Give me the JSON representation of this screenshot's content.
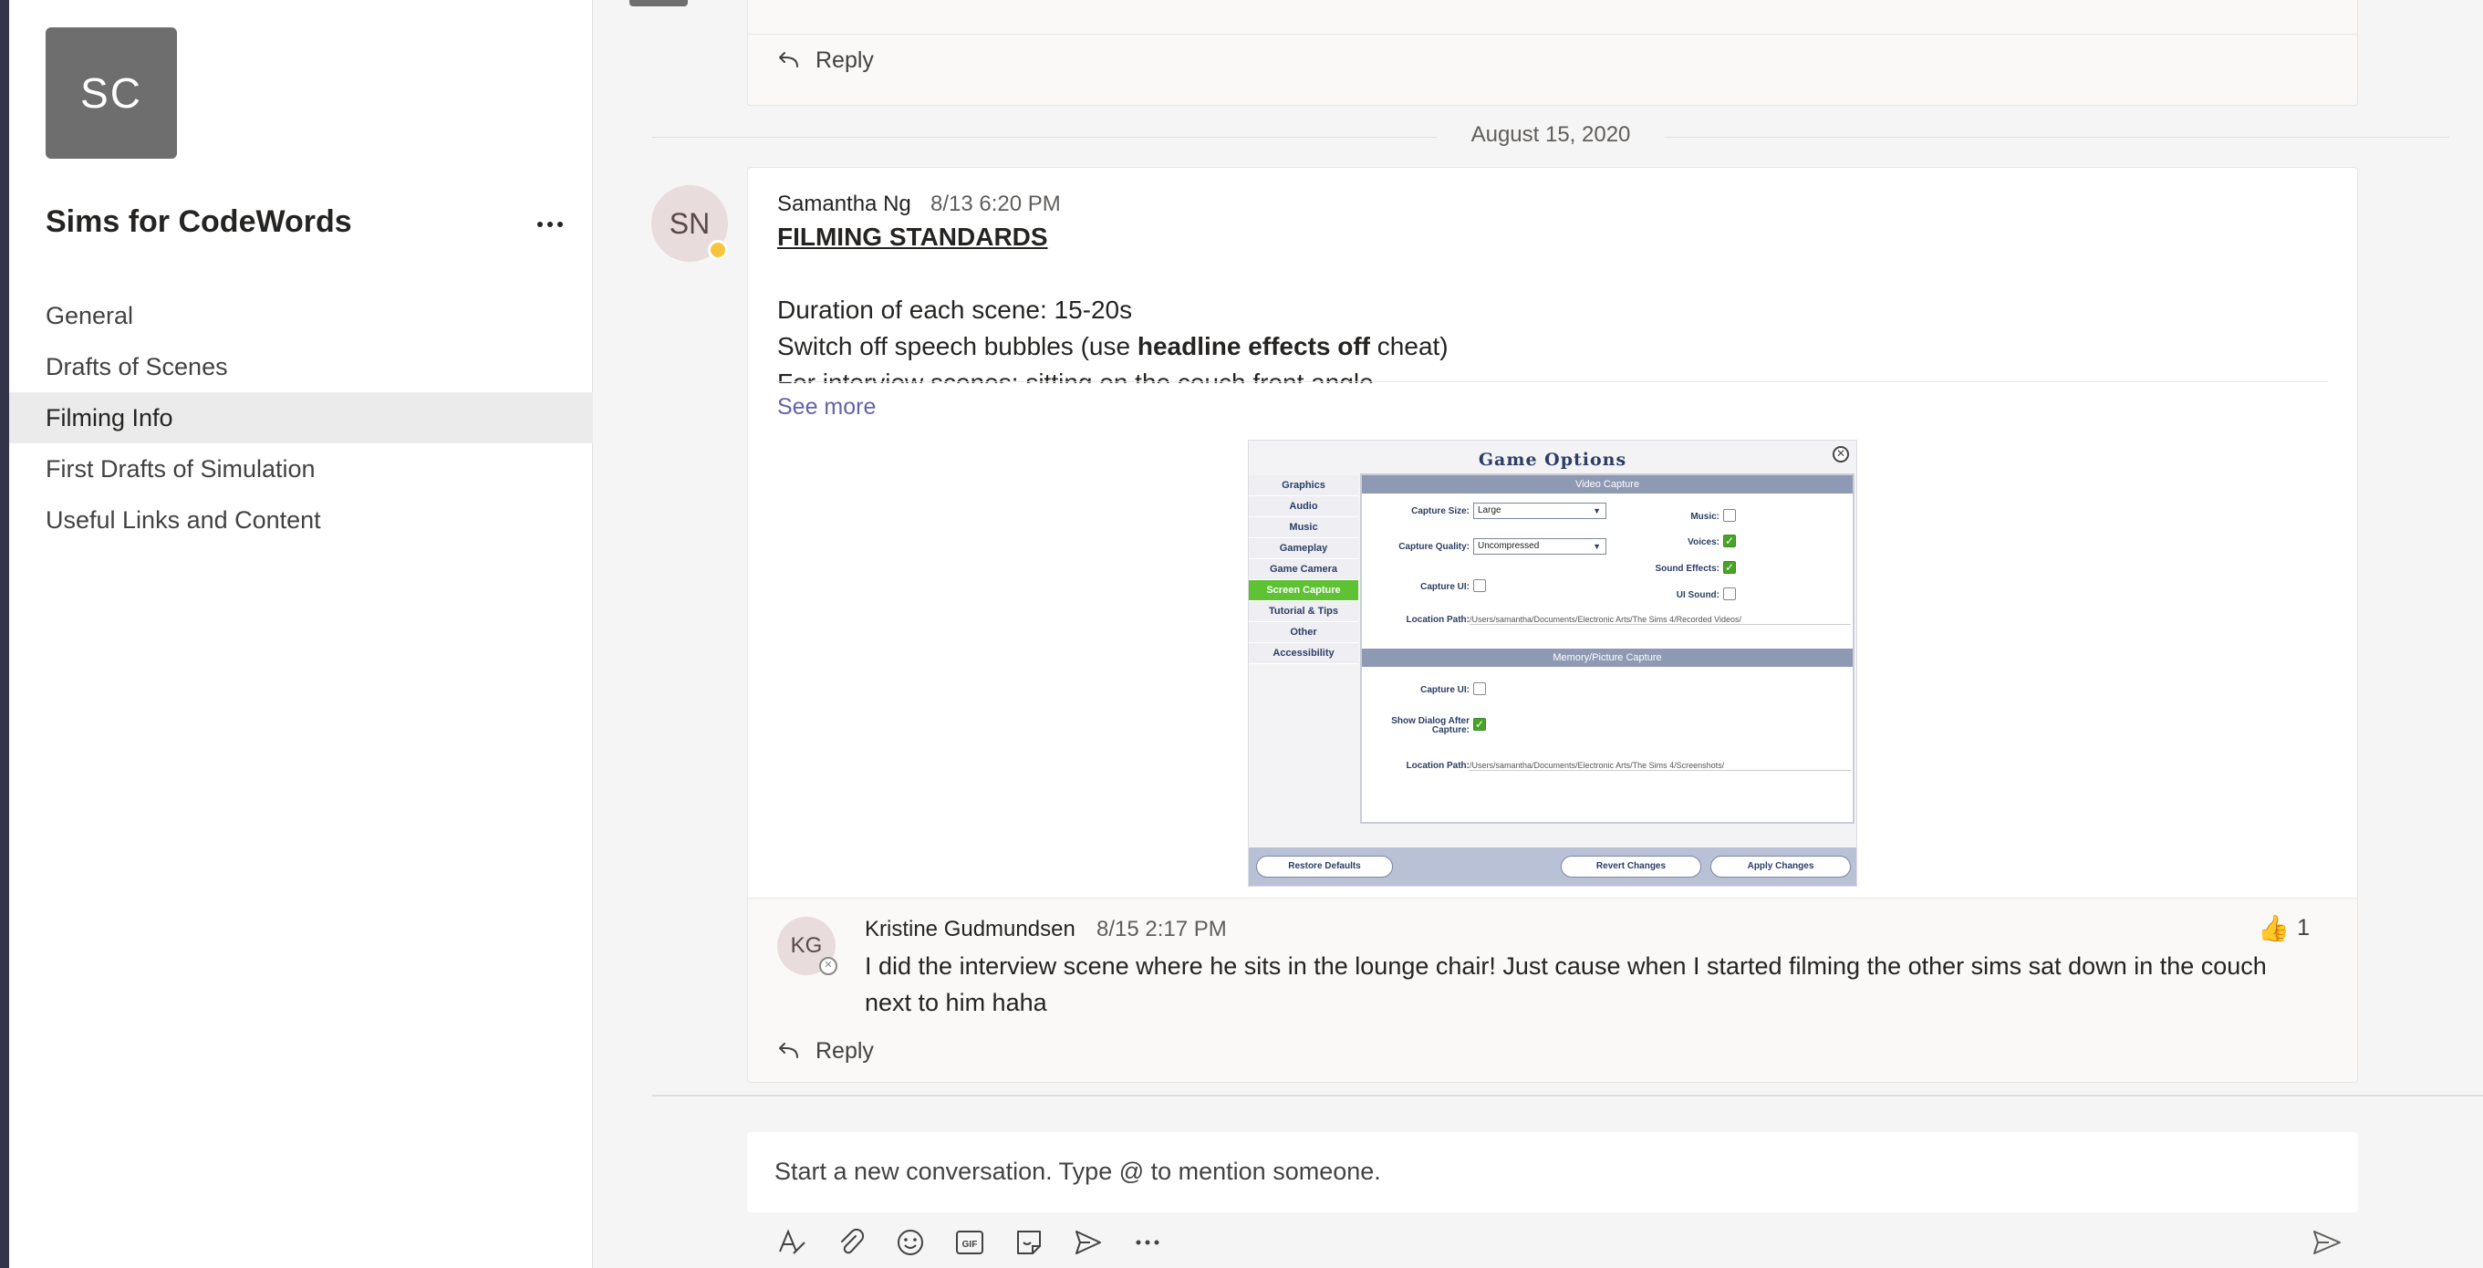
{
  "team": {
    "avatar_initials": "SC",
    "name": "Sims for CodeWords",
    "channels": [
      {
        "label": "General"
      },
      {
        "label": "Drafts of Scenes"
      },
      {
        "label": "Filming Info"
      },
      {
        "label": "First Drafts of Simulation"
      },
      {
        "label": "Useful Links and Content"
      }
    ],
    "active_channel": "Filming Info"
  },
  "top_card": {
    "reply_label": "Reply"
  },
  "date_divider": "August 15, 2020",
  "message": {
    "author_initials": "SN",
    "author": "Samantha Ng",
    "time": "8/13 6:20 PM",
    "title": "FILMING STANDARDS",
    "line1": "Duration of each scene: 15-20s",
    "line2_prefix": "Switch off speech bubbles (use ",
    "line2_bold": "headline effects off",
    "line2_suffix": " cheat)",
    "line3": "For interview scenes: sitting on the couch front angle",
    "see_more": "See more"
  },
  "game_options": {
    "title": "Game Options",
    "close_glyph": "✕",
    "menu": [
      "Graphics",
      "Audio",
      "Music",
      "Gameplay",
      "Game Camera",
      "Screen Capture",
      "Tutorial & Tips",
      "Other",
      "Accessibility"
    ],
    "selected_menu": "Screen Capture",
    "video_section": "Video Capture",
    "capture_size_label": "Capture Size:",
    "capture_size_value": "Large",
    "capture_quality_label": "Capture Quality:",
    "capture_quality_value": "Uncompressed",
    "capture_ui_label": "Capture UI:",
    "music_label": "Music:",
    "voices_label": "Voices:",
    "sound_effects_label": "Sound Effects:",
    "ui_sound_label": "UI Sound:",
    "location_label": "Location Path:",
    "video_path": "/Users/samantha/Documents/Electronic Arts/The Sims 4/Recorded Videos/",
    "memory_section": "Memory/Picture Capture",
    "memory_capture_ui_label": "Capture UI:",
    "show_dialog_label_1": "Show Dialog After",
    "show_dialog_label_2": "Capture:",
    "memory_location_label": "Location Path:",
    "memory_path": "/Users/samantha/Documents/Electronic Arts/The Sims 4/Screenshots/",
    "restore_defaults": "Restore Defaults",
    "revert_changes": "Revert Changes",
    "apply_changes": "Apply Changes"
  },
  "reply": {
    "author_initials": "KG",
    "author": "Kristine Gudmundsen",
    "time": "8/15 2:17 PM",
    "text": "I did the interview scene where he sits in the lounge chair! Just cause when I started filming the other sims sat down in the couch next to him haha",
    "reaction_count": "1",
    "reply_label": "Reply"
  },
  "compose": {
    "placeholder": "Start a new conversation. Type @ to mention someone."
  },
  "colors": {
    "accent": "#6264a7",
    "sidebar_active": "#ebebeb",
    "screen_capture_selected": "#5ec234"
  }
}
